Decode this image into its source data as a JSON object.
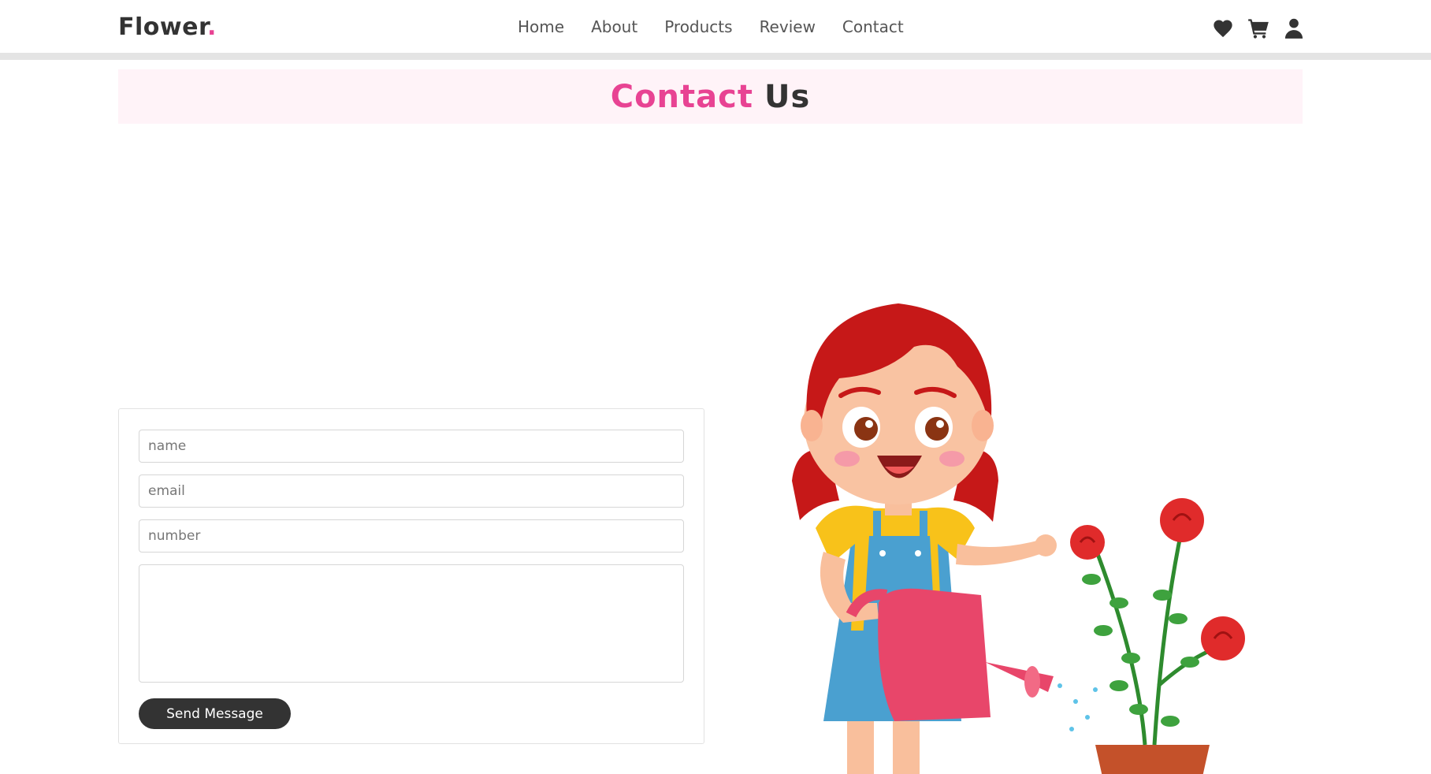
{
  "header": {
    "logo_text": "Flower",
    "logo_dot": ".",
    "nav": [
      "Home",
      "About",
      "Products",
      "Review",
      "Contact"
    ],
    "icons": [
      "heart-icon",
      "cart-icon",
      "user-icon"
    ]
  },
  "heading": {
    "highlight": "Contact",
    "rest": "Us"
  },
  "form": {
    "name_placeholder": "name",
    "email_placeholder": "email",
    "number_placeholder": "number",
    "message_placeholder": "",
    "submit_label": "Send Message"
  },
  "colors": {
    "accent": "#e84393",
    "dark": "#333333",
    "heading_bg": "#fff3f8"
  }
}
